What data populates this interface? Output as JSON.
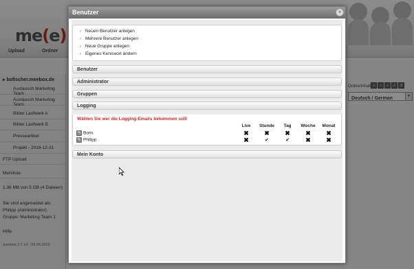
{
  "background": {
    "logo": {
      "pre": "me",
      "bracket_open": "(",
      "mid": "e",
      "bracket_close": ")"
    },
    "nav": [
      "Upload",
      "Ordner"
    ],
    "language": "Deutsch / German",
    "sidebar": {
      "user": "bofischer.meebox.de",
      "folders": [
        "Austausch Marketing Team",
        "Austausch Marketing Team",
        "Bilder Laufwerk A",
        "Bilder Laufwerk B",
        "Presseartikel",
        "Projekt - 2016-12-31"
      ],
      "ftp": "FTP Upload",
      "merkliste": "Merkliste",
      "storage": "1.36 MB von 5 GB (4 Dateien)",
      "signed_in_label": "Sie sind angemeldet als:",
      "signed_in_user": "Philipp (Administrator)",
      "signed_in_group": "Gruppe: Marketing Team 1",
      "help": "Hilfe",
      "version": "meebox 2.7.14 - 06.04.2016"
    },
    "toolbar_label": "Ordnerinhalt",
    "toolbar_icons": [
      "arrow-right-icon",
      "arrow-up-icon",
      "arrow-down-icon",
      "check-icon",
      "list-icon"
    ]
  },
  "modal": {
    "title": "Benutzer",
    "close": "×",
    "actions": [
      "Neuen Benutzer anlegen",
      "Mehrere Benutzer anlegen",
      "Neue Gruppe anlegen",
      "Eigenes Kennwort ändern"
    ],
    "sections": {
      "benutzer": "Benutzer",
      "administrator": "Administrator",
      "gruppen": "Gruppen",
      "logging": "Logging",
      "mein_konto": "Mein Konto"
    },
    "logging": {
      "prompt": "Wählen Sie wer die Logging-Emails bekommen soll!",
      "columns": [
        "Live",
        "Stunde",
        "Tag",
        "Woche",
        "Monat"
      ],
      "rows": [
        {
          "user": "Boris",
          "values": [
            "✖",
            "✖",
            "✖",
            "✖",
            "✖"
          ]
        },
        {
          "user": "Philipp",
          "values": [
            "✖",
            "✔",
            "✔",
            "✖",
            "✖"
          ]
        }
      ]
    }
  }
}
